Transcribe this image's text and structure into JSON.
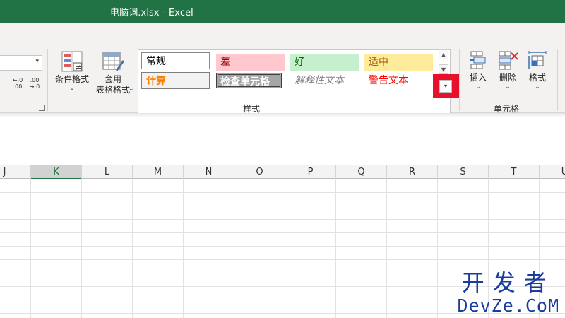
{
  "window": {
    "title": "电脑词.xlsx  -  Excel"
  },
  "ribbon": {
    "number_group": {
      "format_value": "",
      "increase_decimal": {
        "top": "←.0",
        "bottom": ".00"
      },
      "decrease_decimal": {
        "top": ".00",
        "bottom": "→.0"
      }
    },
    "styles_group": {
      "label": "样式",
      "conditional_formatting": "条件格式",
      "format_as_table": "套用\n表格格式",
      "gallery": {
        "normal": "常规",
        "bad": "差",
        "good": "好",
        "neutral": "适中",
        "calculation": "计算",
        "check_cell": "检查单元格",
        "explanatory": "解释性文本",
        "warning": "警告文本"
      }
    },
    "cells_group": {
      "label": "单元格",
      "insert": "插入",
      "delete": "删除",
      "format": "格式"
    }
  },
  "sheet": {
    "columns": [
      "J",
      "K",
      "L",
      "M",
      "N",
      "O",
      "P",
      "Q",
      "R",
      "S",
      "T",
      "U"
    ],
    "selected_column": "K"
  },
  "watermark": {
    "line1": "开发者",
    "line2": "DevZe.CoM"
  },
  "colors": {
    "excel_green": "#217346",
    "highlight_red": "#e8102a"
  }
}
